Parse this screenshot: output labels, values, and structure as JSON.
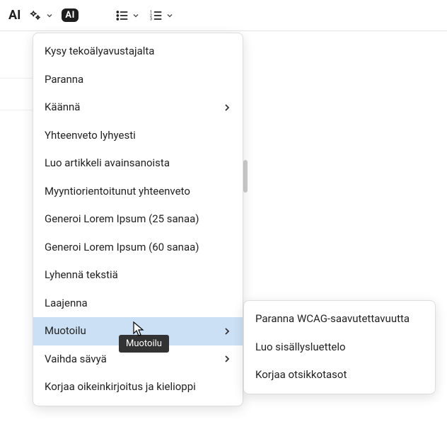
{
  "toolbar": {
    "ai_label": "AI",
    "ai_badge": "AI"
  },
  "menu": {
    "items": [
      {
        "label": "Kysy tekoälyavustajalta",
        "has_sub": false
      },
      {
        "label": "Paranna",
        "has_sub": false
      },
      {
        "label": "Käännä",
        "has_sub": true
      },
      {
        "label": "Yhteenveto lyhyesti",
        "has_sub": false
      },
      {
        "label": "Luo artikkeli avainsanoista",
        "has_sub": false
      },
      {
        "label": "Myyntiorientoitunut yhteenveto",
        "has_sub": false
      },
      {
        "label": "Generoi Lorem Ipsum (25 sanaa)",
        "has_sub": false
      },
      {
        "label": "Generoi Lorem Ipsum (60 sanaa)",
        "has_sub": false
      },
      {
        "label": "Lyhennä tekstiä",
        "has_sub": false
      },
      {
        "label": "Laajenna",
        "has_sub": false
      },
      {
        "label": "Muotoilu",
        "has_sub": true,
        "hovered": true
      },
      {
        "label": "Vaihda sävyä",
        "has_sub": true
      },
      {
        "label": "Korjaa oikeinkirjoitus ja kielioppi",
        "has_sub": false
      }
    ]
  },
  "submenu": {
    "items": [
      {
        "label": "Paranna WCAG-saavutettavuutta"
      },
      {
        "label": "Luo sisällysluettelo"
      },
      {
        "label": "Korjaa otsikkotasot"
      }
    ]
  },
  "tooltip": "Muotoilu"
}
